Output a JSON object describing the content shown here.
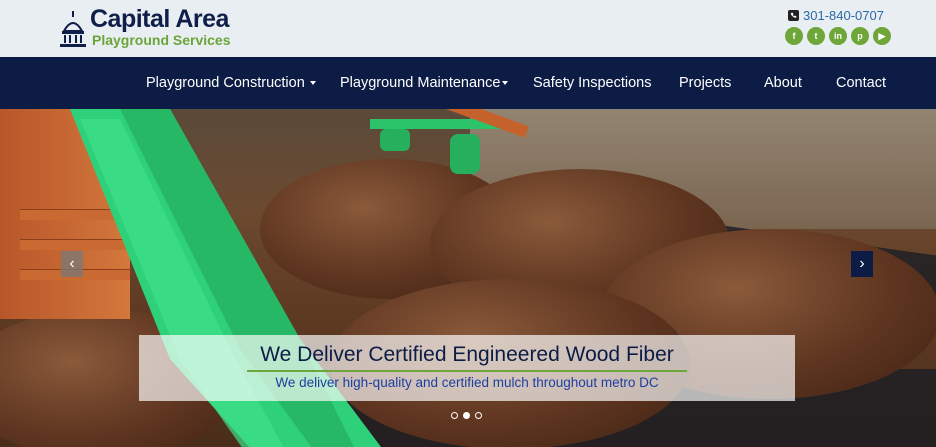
{
  "brand": {
    "title": "Capital Area",
    "subtitle": "Playground Services",
    "logo_icon": "capitol-dome-icon",
    "title_color": "#0f1f4a",
    "subtitle_color": "#6aa53a"
  },
  "contact": {
    "phone": "301-840-0707",
    "phone_icon": "phone-icon"
  },
  "socials": [
    {
      "name": "facebook-icon",
      "glyph": "f"
    },
    {
      "name": "twitter-icon",
      "glyph": "t"
    },
    {
      "name": "linkedin-icon",
      "glyph": "in"
    },
    {
      "name": "pinterest-icon",
      "glyph": "p"
    },
    {
      "name": "youtube-icon",
      "glyph": "▶"
    }
  ],
  "nav": {
    "items": [
      {
        "label": "Playground Construction",
        "dropdown": true
      },
      {
        "label": "Playground Maintenance",
        "dropdown": true
      },
      {
        "label": "Safety Inspections",
        "dropdown": false
      },
      {
        "label": "Projects",
        "dropdown": false
      },
      {
        "label": "About",
        "dropdown": false
      },
      {
        "label": "Contact",
        "dropdown": false
      }
    ],
    "background": "#0c1c45"
  },
  "hero": {
    "title": "We Deliver Certified Engineered Wood Fiber",
    "subtitle": "We deliver high-quality and certified mulch throughout metro DC",
    "prev_label": "‹",
    "next_label": "›",
    "slide_count": 3,
    "active_slide": 2
  },
  "colors": {
    "accent_green": "#6fa63a",
    "navy": "#0c1c45",
    "link_blue": "#2b6aa8"
  }
}
